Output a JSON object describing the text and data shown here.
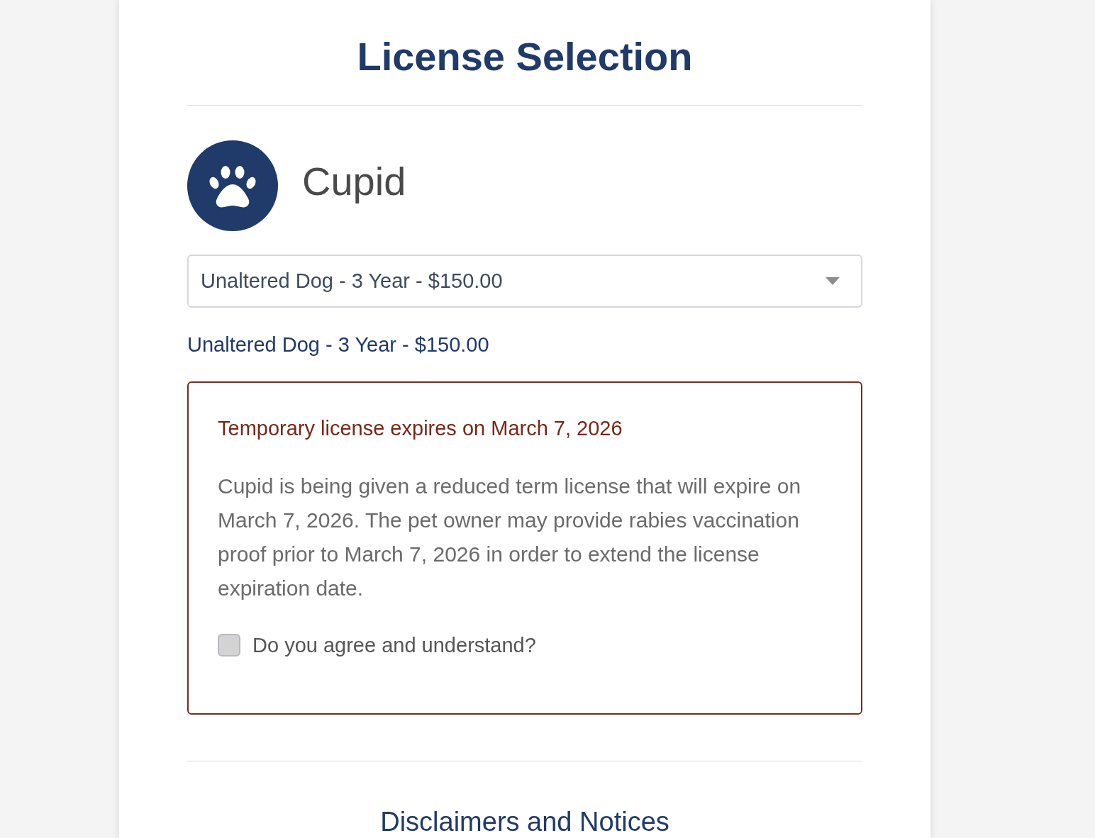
{
  "page_title": "License Selection",
  "pet": {
    "name": "Cupid"
  },
  "license_select": {
    "value": "Unaltered Dog - 3 Year - $150.00"
  },
  "selected_license": "Unaltered Dog - 3 Year - $150.00",
  "notice": {
    "title": "Temporary license expires on March 7, 2026",
    "body": "Cupid is being given a reduced term license that will expire on March 7, 2026. The pet owner may provide rabies vaccination proof prior to March 7, 2026 in order to extend the license expiration date.",
    "agreement": {
      "label": "Do you agree and understand?",
      "checked": false
    }
  },
  "next_section": {
    "title": "Disclaimers and Notices"
  }
}
